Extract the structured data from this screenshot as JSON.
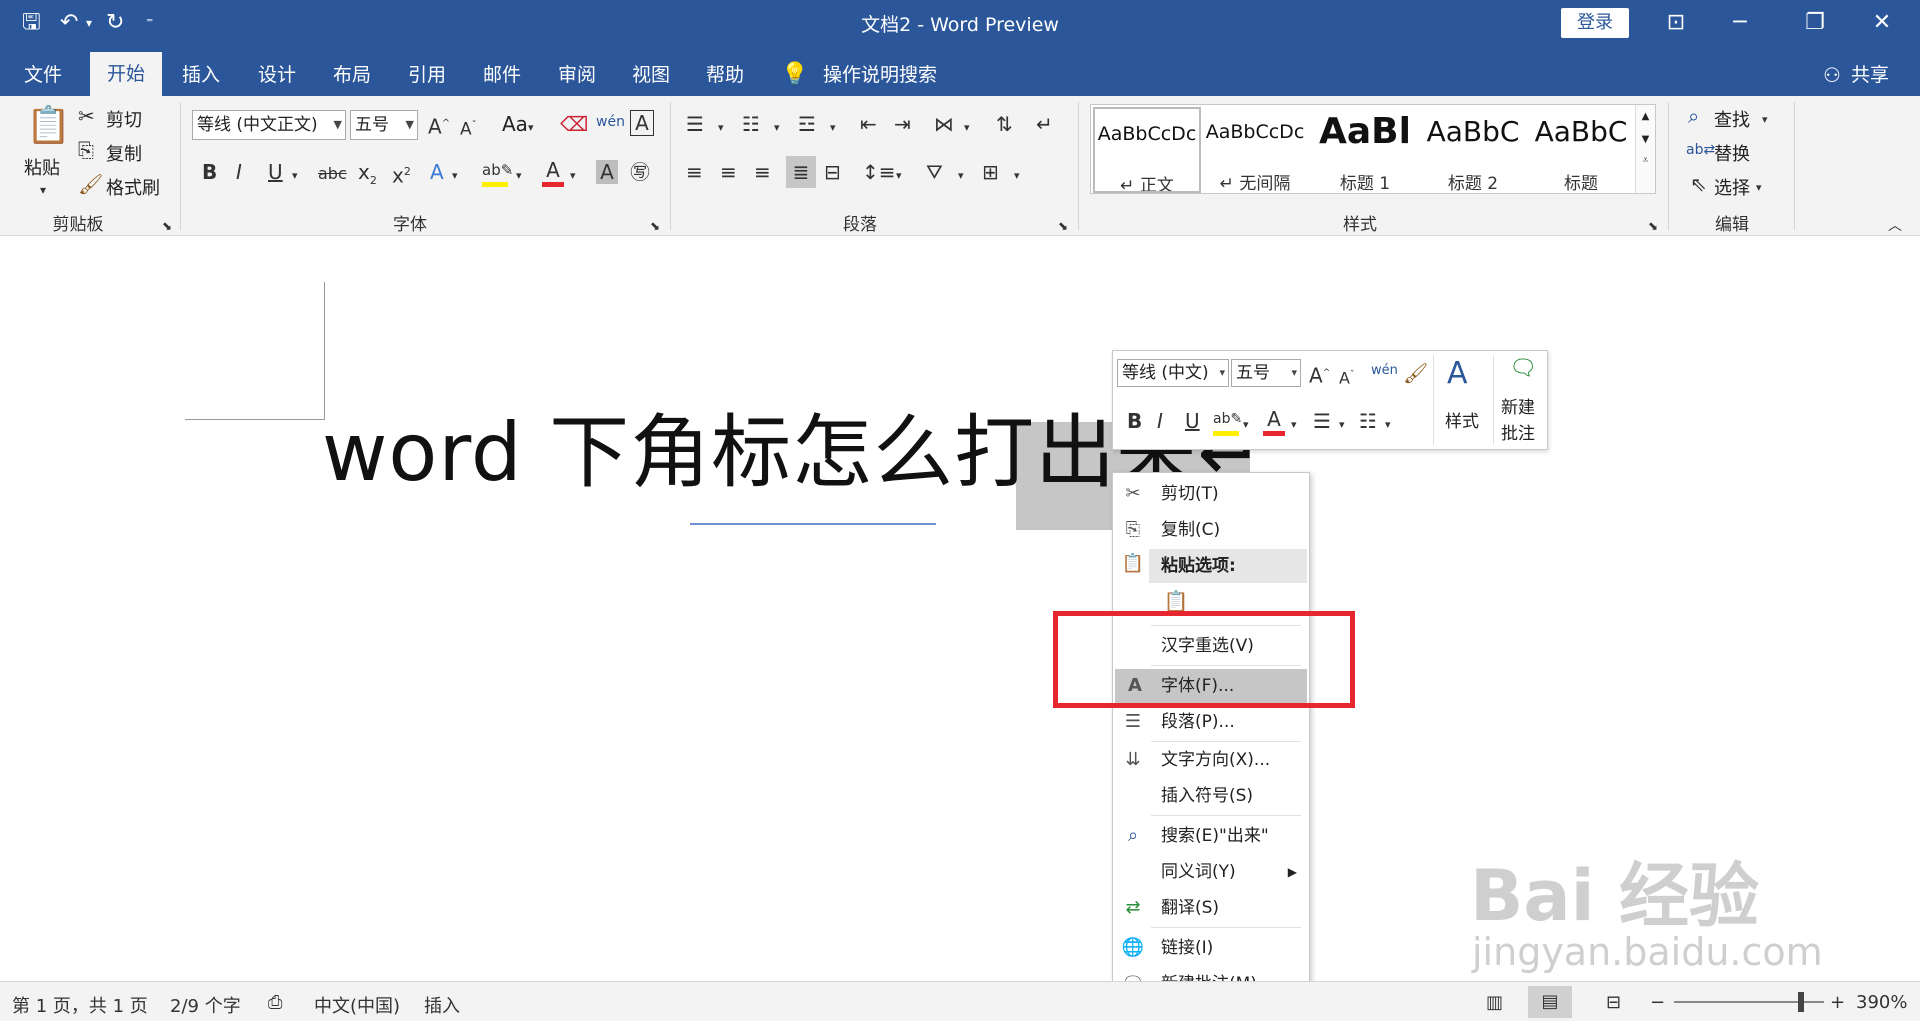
{
  "titlebar": {
    "title": "文档2  -  Word Preview",
    "login": "登录"
  },
  "tabs": [
    "文件",
    "开始",
    "插入",
    "设计",
    "布局",
    "引用",
    "邮件",
    "审阅",
    "视图",
    "帮助"
  ],
  "search_tab": "操作说明搜索",
  "share": "共享",
  "clipboard": {
    "paste": "粘贴",
    "cut": "剪切",
    "copy": "复制",
    "format_painter": "格式刷",
    "label": "剪贴板"
  },
  "font": {
    "name": "等线 (中文正文)",
    "size": "五号",
    "label": "字体",
    "case": "Aa"
  },
  "paragraph": {
    "label": "段落"
  },
  "styles": {
    "label": "样式",
    "items": [
      {
        "sample": "AaBbCcDc",
        "name": "↵ 正文"
      },
      {
        "sample": "AaBbCcDc",
        "name": "↵ 无间隔"
      },
      {
        "sample": "AaBl",
        "name": "标题 1"
      },
      {
        "sample": "AaBbC",
        "name": "标题 2"
      },
      {
        "sample": "AaBbC",
        "name": "标题"
      }
    ]
  },
  "editing": {
    "find": "查找",
    "replace": "替换",
    "select": "选择",
    "label": "编辑"
  },
  "document": {
    "text": "word 下角标怎么打出来↵"
  },
  "mini_toolbar": {
    "font": "等线 (中文)",
    "size": "五号",
    "style": "样式",
    "new_comment_1": "新建",
    "new_comment_2": "批注"
  },
  "context_menu": {
    "cut": "剪切(T)",
    "copy": "复制(C)",
    "paste_options": "粘贴选项:",
    "reconvert": "汉字重选(V)",
    "font": "字体(F)...",
    "paragraph": "段落(P)...",
    "text_direction": "文字方向(X)...",
    "insert_symbol": "插入符号(S)",
    "search": "搜索(E)\"出来\"",
    "synonyms": "同义词(Y)",
    "translate": "翻译(S)",
    "link": "链接(I)",
    "new_comment": "新建批注(M)"
  },
  "statusbar": {
    "page": "第 1 页，共 1 页",
    "words": "2/9 个字",
    "language": "中文(中国)",
    "mode": "插入",
    "zoom": "390%"
  },
  "watermark": {
    "brand": "Bai 经验",
    "url": "jingyan.baidu.com"
  },
  "colors": {
    "accent": "#2b579a",
    "highlight_box": "#e8262f"
  }
}
